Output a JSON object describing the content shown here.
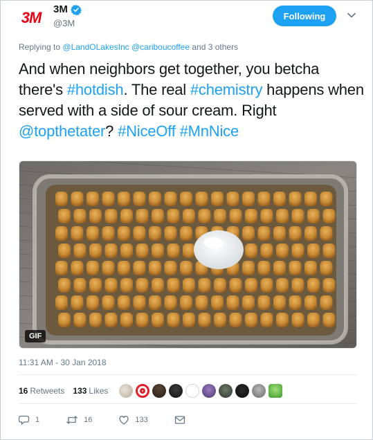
{
  "account": {
    "logo_text": "3M",
    "display_name": "3M",
    "handle": "@3M",
    "verified": true,
    "follow_label": "Following"
  },
  "reply": {
    "prefix": "Replying to",
    "mention_1": "@LandOLakesInc",
    "mention_2": "@cariboucoffee",
    "suffix": "and 3 others"
  },
  "tweet": {
    "seg_1": "And when neighbors get together, you betcha there's ",
    "tag_1": "#hotdish",
    "seg_2": ". The real ",
    "tag_2": "#chemistry",
    "seg_3": " happens when served with a side of sour cream. Right ",
    "tag_3": "@topthetater",
    "seg_4": "? ",
    "tag_4": "#NiceOff",
    "seg_5": " ",
    "tag_5": "#MnNice"
  },
  "media": {
    "badge": "GIF"
  },
  "timestamp": "11:31 AM - 30 Jan 2018",
  "stats": {
    "retweets_count": "16",
    "retweets_label": "Retweets",
    "likes_count": "133",
    "likes_label": "Likes"
  },
  "actions": {
    "replies": "1",
    "retweets": "16",
    "likes": "133"
  },
  "colors": {
    "accent": "#1da1f2",
    "brand_red": "#e60012",
    "muted": "#657786"
  }
}
